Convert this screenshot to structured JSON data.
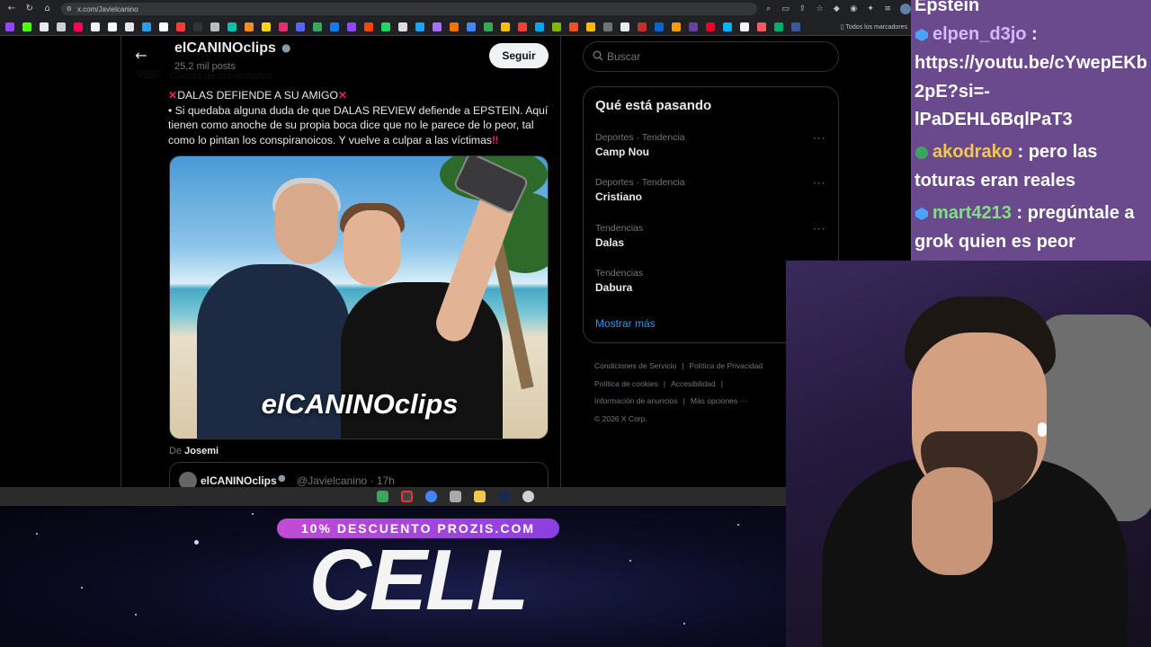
{
  "browser": {
    "url": "x.com/Javielcanino",
    "bookmarks_folder": "Todos los marcadores"
  },
  "header": {
    "profile_name": "elCANINOclips",
    "post_count": "25,2 mil posts",
    "follow_label": "Seguir"
  },
  "tweet": {
    "context_line": "Cuenta de comentarios",
    "text_line1": "DALAS DEFIENDE A SU AMIGO",
    "text_body": "• Si quedaba alguna duda de que DALAS REVIEW defiende a EPSTEIN. Aquí tienen como anoche de su propia boca dice que no le parece de lo peor, tal como lo pintan los conspiranoicos. Y vuelve a culpar a las víctimas",
    "media_watermark": "elCANINOclips",
    "via_prefix": "De",
    "via_user": "Josemi",
    "quote_name": "elCANINOclips",
    "quote_handle": "@Javielcanino · 17h"
  },
  "search": {
    "placeholder": "Buscar"
  },
  "trends": {
    "title": "Qué está pasando",
    "items": [
      {
        "meta": "Deportes · Tendencia",
        "name": "Camp Nou"
      },
      {
        "meta": "Deportes · Tendencia",
        "name": "Cristiano"
      },
      {
        "meta": "Tendencias",
        "name": "Dalas"
      },
      {
        "meta": "Tendencias",
        "name": "Dabura"
      }
    ],
    "show_more": "Mostrar más"
  },
  "footer": {
    "terms": "Condiciones de Servicio",
    "privacy": "Política de Privacidad",
    "cookies": "Política de cookies",
    "accessibility": "Accesibilidad",
    "ads": "Información de anuncios",
    "more": "Más opciones ···",
    "copyright": "© 2026 X Corp."
  },
  "chat": {
    "line0": "Epstein",
    "msg1_user": "elpen_d3jo",
    "msg1_text_a": "https://youtu.be/cYwepEKb",
    "msg1_text_b": "2pE?si=-",
    "msg1_text_c": "lPaDEHL6BqlPaT3",
    "msg2_user": "akodrako",
    "msg2_text_a": ": pero las",
    "msg2_text_b": "toturas eran reales",
    "msg3_user": "mart4213",
    "msg3_text_a": ": pregúntale a",
    "msg3_text_b": "grok quien es peor"
  },
  "promo": {
    "banner": "10% DESCUENTO PROZIS.COM",
    "word": "CELL"
  },
  "colors": {
    "accent": "#1d9bf0",
    "chat_user_1": "#d7b8ff",
    "chat_user_2": "#f2c94c",
    "chat_user_3": "#7ee081"
  }
}
